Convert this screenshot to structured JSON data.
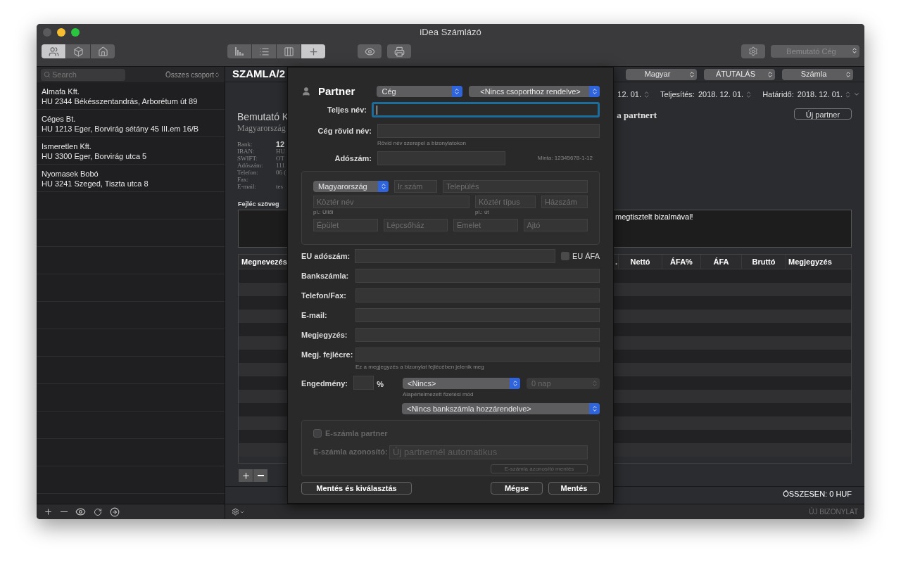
{
  "window": {
    "title": "iDea Számlázó"
  },
  "toolbar": {
    "view_tabs": [
      {
        "selected": true
      },
      {
        "selected": false
      },
      {
        "selected": false
      }
    ],
    "mode_tabs": [
      {
        "selected": false
      },
      {
        "selected": false
      },
      {
        "selected": false
      },
      {
        "selected": true
      }
    ],
    "company_popup": "Bemutató Cég"
  },
  "sidebar": {
    "search_placeholder": "Search",
    "group_filter": "Összes csoport",
    "partners": [
      {
        "name": "Almafa Kft.",
        "address": "HU 2344 Békésszentandrás, Arborétum út 89"
      },
      {
        "name": "Céges Bt.",
        "address": "HU 1213 Eger, Borvirág sétány 45 III.em 16/B"
      },
      {
        "name": "Ismeretlen Kft.",
        "address": "HU 3300 Eger, Borvirág utca 5"
      },
      {
        "name": "Nyomasek Bobó",
        "address": "HU 3241 Szeged, Tiszta utca 8"
      }
    ]
  },
  "document": {
    "number": "SZAMLA/2",
    "popups": [
      "Magyar",
      "ÁTUTALÁS",
      "Számla"
    ],
    "dates": [
      {
        "value": "12. 01."
      },
      {
        "label": "Teljesítés:",
        "value": "2018. 12. 01."
      },
      {
        "label": "Határidő:",
        "value": "2018. 12. 01."
      }
    ],
    "seller": {
      "name": "Bemutató K",
      "address": "Magyarország"
    },
    "seller_details": [
      {
        "label": "Bank:",
        "value": "12"
      },
      {
        "label": "IBAN:",
        "value": "HU"
      },
      {
        "label": "SWIFT:",
        "value": "OT"
      },
      {
        "label": "Adószám:",
        "value": "111"
      },
      {
        "label": "Telefon:",
        "value": "06 ("
      },
      {
        "label": "Fax:"
      },
      {
        "label": "E-mail:",
        "value": "tes"
      }
    ],
    "buyer_prompt": "a partnert",
    "new_partner_button": "Új partner",
    "header_text_label": "Fejléc szöveg",
    "header_text": "megtisztelt bizalmával!",
    "columns_left": [
      "Megnevezés"
    ],
    "columns_right": [
      ".",
      "Nettó",
      "ÁFA%",
      "ÁFA",
      "Bruttó",
      "Megjegyzés"
    ],
    "total": "ÖSSZESEN: 0 HUF",
    "new_document_button": "ÚJ BIZONYLAT"
  },
  "dialog": {
    "title": "Partner",
    "type_popup": "Cég",
    "group_popup": "<Nincs csoporthoz rendelve>",
    "full_name": {
      "label": "Teljes név:",
      "focused": true
    },
    "short_name": {
      "label": "Cég rövid név:",
      "hint": "Rövid név szerepel a bizonylatokon"
    },
    "tax_number": {
      "label": "Adószám:",
      "example": "Minta: 12345678-1-12"
    },
    "address": {
      "country": "Magyarország",
      "rows": [
        [
          {
            "placeholder": "Ir.szám"
          },
          {
            "placeholder": "Település"
          }
        ],
        [
          {
            "placeholder": "Köztér név",
            "hint": "pl.: Üllői"
          },
          {
            "placeholder": "Köztér típus",
            "hint": "pl.: út"
          },
          {
            "placeholder": "Házszám"
          }
        ],
        [
          {
            "placeholder": "Épület"
          },
          {
            "placeholder": "Lépcsőház"
          },
          {
            "placeholder": "Emelet"
          },
          {
            "placeholder": "Ajtó"
          }
        ]
      ]
    },
    "eu_tax": {
      "label": "EU adószám:",
      "checkbox": "EU ÁFA",
      "checked": false
    },
    "fields": [
      {
        "label": "Bankszámla:"
      },
      {
        "label": "Telefon/Fax:"
      },
      {
        "label": "E-mail:"
      },
      {
        "label": "Megjegyzés:"
      },
      {
        "label": "Megj. fejlécre:",
        "hint": "Ez a megjegyzés a bizonylat fejlécében jelenik meg"
      }
    ],
    "discount": {
      "label": "Engedmény:",
      "unit": "%",
      "payment_popup": "<Nincs>",
      "days_popup": "0 nap",
      "days_disabled": true,
      "payment_hint": "Alapértelmezett fizetési mód",
      "bank_popup": "<Nincs bankszámla hozzárendelve>"
    },
    "einvoice": {
      "disabled": true,
      "checkbox": "E-számla partner",
      "checked": false,
      "id_label": "E-számla azonosító:",
      "id_placeholder": "Új partnernél automatikus",
      "save_button": "E-számla azonosító mentés"
    },
    "buttons": {
      "save_select": "Mentés és kiválasztás",
      "cancel": "Mégse",
      "save": "Mentés"
    }
  }
}
